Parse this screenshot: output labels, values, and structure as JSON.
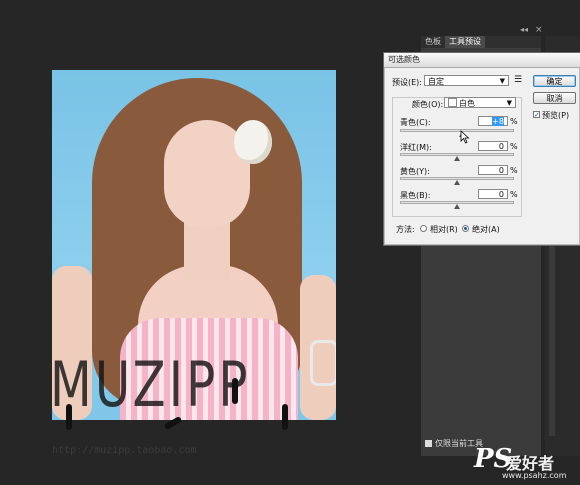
{
  "panels": {
    "tabs": [
      "色板",
      "工具预设"
    ],
    "active_tab": "工具预设",
    "collapse_arrows": "◂◂",
    "close_glyph": "×"
  },
  "dialog": {
    "title": "可选颜色",
    "preset_label": "预设(E):",
    "preset_value": "自定",
    "colors_label": "颜色(O):",
    "colors_value": "白色",
    "rows": [
      {
        "label": "青色(C):",
        "value": "+8",
        "unit": "%",
        "slider": 0.54
      },
      {
        "label": "洋红(M):",
        "value": "0",
        "unit": "%",
        "slider": 0.5
      },
      {
        "label": "黄色(Y):",
        "value": "0",
        "unit": "%",
        "slider": 0.5
      },
      {
        "label": "黑色(B):",
        "value": "0",
        "unit": "%",
        "slider": 0.5
      }
    ],
    "ok_label": "确定",
    "cancel_label": "取消",
    "preview_label": "预览(P)",
    "preview_checked": true,
    "method_label": "方法:",
    "relative_label": "相对(R)",
    "absolute_label": "绝对(A)",
    "method_selected": "absolute"
  },
  "canvas": {
    "watermark": "MUZIPP",
    "watermark_url": "http://muzipp.taobao.com"
  },
  "tool_option": {
    "current_tool_only_label": "仅限当前工具"
  },
  "brand": {
    "logo_ps": "PS",
    "logo_cn": "爱好者",
    "site": "www.psahz.com"
  },
  "colors": {
    "background": "#262626",
    "dialog_bg": "#f0f0f0",
    "highlight": "#3399ff"
  }
}
